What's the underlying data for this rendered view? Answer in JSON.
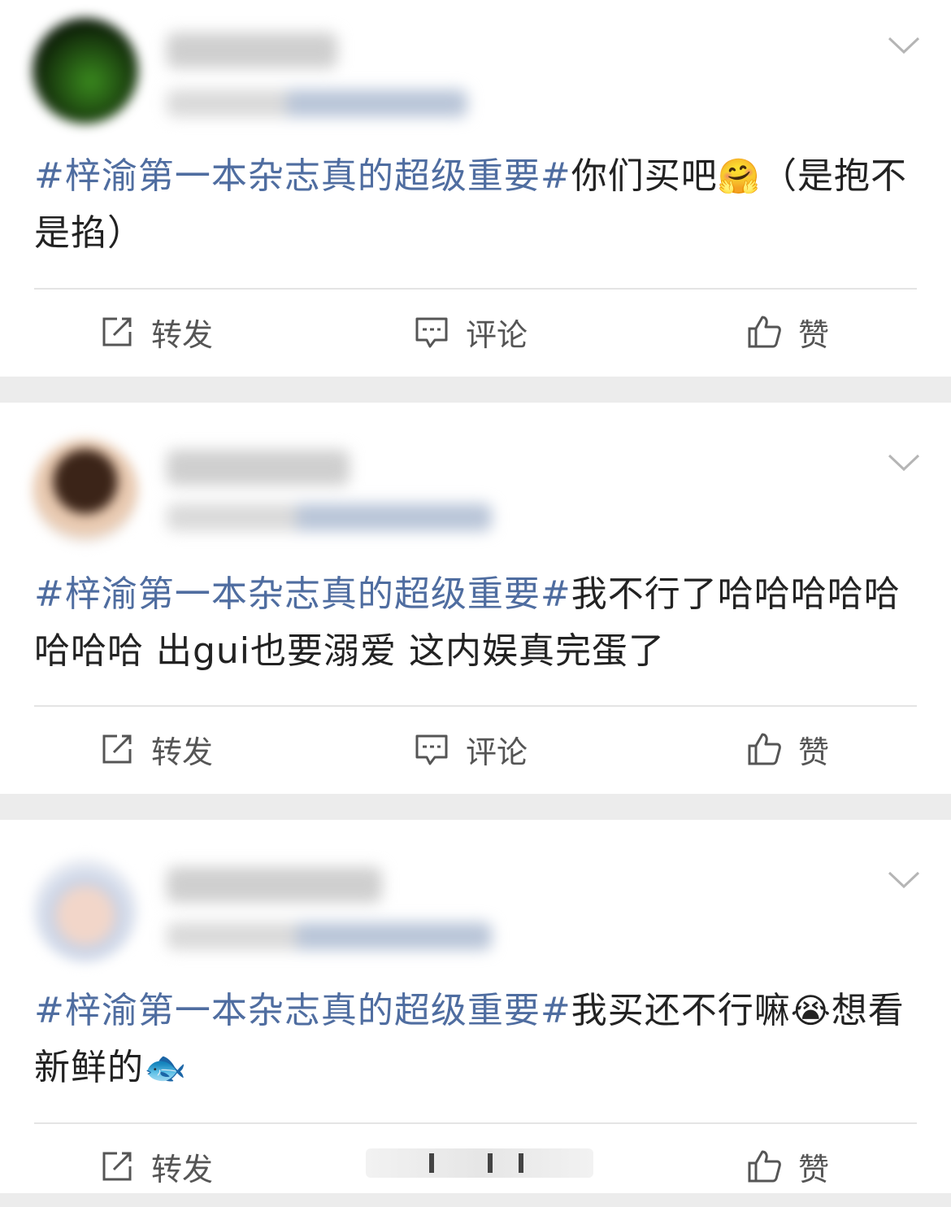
{
  "colors": {
    "topic": "#4f6da0",
    "text": "#222222",
    "action": "#555555"
  },
  "actions": {
    "repost": "转发",
    "comment": "评论",
    "like": "赞"
  },
  "posts": [
    {
      "topic": "#梓渝第一本杂志真的超级重要#",
      "body_before": "你们买吧",
      "emoji": "🤗",
      "body_after": "（是抱不是掐）"
    },
    {
      "topic": "#梓渝第一本杂志真的超级重要#",
      "body_before": "我不行了哈哈哈哈哈哈哈哈 出gui也要溺爱 这内娱真完蛋了",
      "emoji": "",
      "body_after": ""
    },
    {
      "topic": "#梓渝第一本杂志真的超级重要#",
      "body_before": "我买还不行嘛",
      "emoji": "😭",
      "body_after": "想看新鲜的",
      "emoji2": "🐟"
    }
  ]
}
